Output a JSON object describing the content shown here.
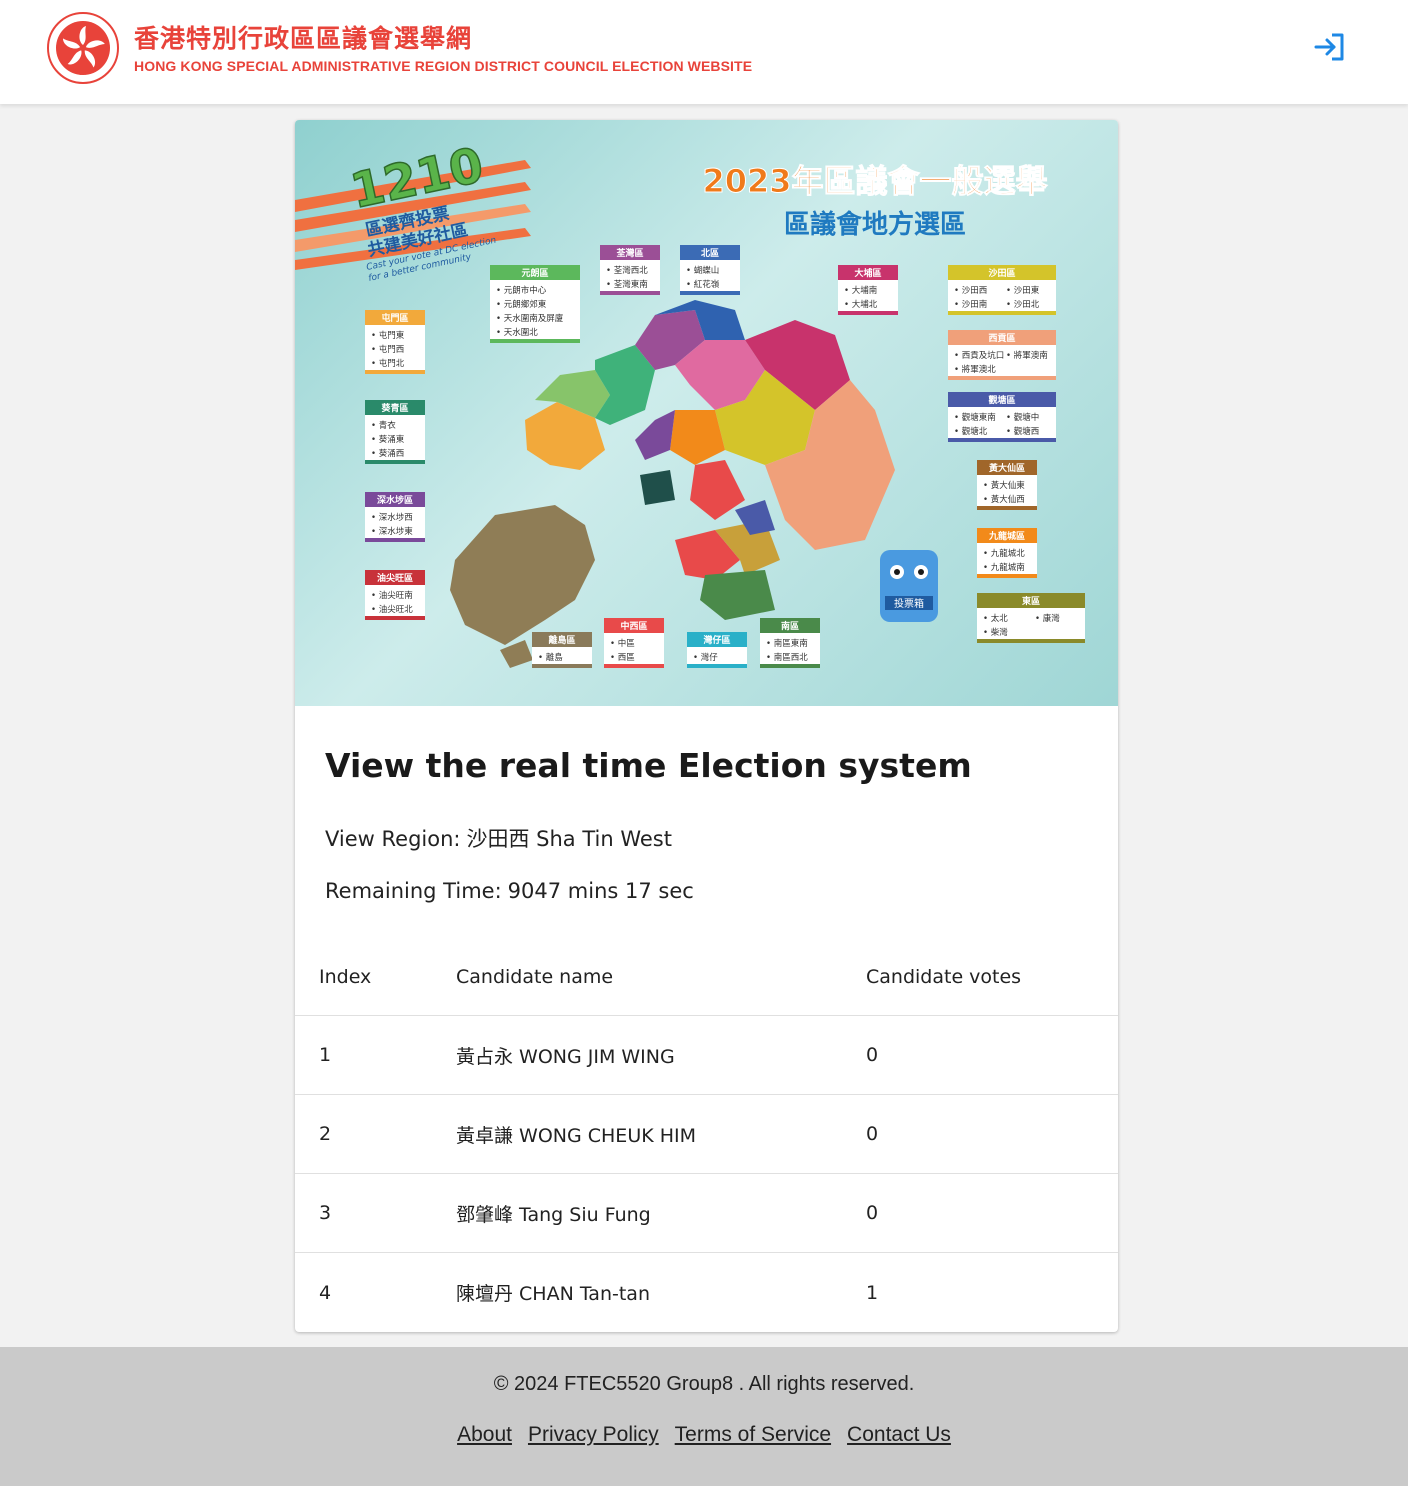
{
  "header": {
    "title_zh": "香港特別行政區區議會選舉網",
    "title_en": "HONG KONG SPECIAL ADMINISTRATIVE REGION DISTRICT COUNCIL ELECTION WEBSITE",
    "login_icon": "login-icon",
    "logo_text": "HONG KONG",
    "brand_color": "#e8433a",
    "accent_color": "#1e88e5"
  },
  "banner": {
    "slogan_number": "1210",
    "slogan_line1": "區選齊投票",
    "slogan_line2": "共建美好社區",
    "slogan_en1": "Cast your vote at DC election",
    "slogan_en2": "for a better community",
    "heading_year": "2023年區議會一般選舉",
    "heading_sub": "區議會地方選區",
    "mascot_label": "投票箱",
    "districts": [
      {
        "name": "屯門區",
        "items": [
          "屯門東",
          "屯門西",
          "屯門北"
        ],
        "color": "#f2a93b"
      },
      {
        "name": "元朗區",
        "items": [
          "元朗市中心",
          "元朗鄉郊東",
          "天水圍南及屏廈",
          "天水圍北"
        ],
        "color": "#5cb85c"
      },
      {
        "name": "荃灣區",
        "items": [
          "荃灣西北",
          "荃灣東南"
        ],
        "color": "#9b4f96"
      },
      {
        "name": "北區",
        "items": [
          "蝴蝶山",
          "紅花嶺"
        ],
        "color": "#3b6bb5"
      },
      {
        "name": "大埔區",
        "items": [
          "大埔南",
          "大埔北"
        ],
        "color": "#c8336c"
      },
      {
        "name": "沙田區",
        "items": [
          "沙田西",
          "沙田東",
          "沙田南",
          "沙田北"
        ],
        "color": "#d4c42a"
      },
      {
        "name": "西貢區",
        "items": [
          "西貢及坑口",
          "將軍澳南",
          "將軍澳北"
        ],
        "color": "#f0a07a"
      },
      {
        "name": "觀塘區",
        "items": [
          "觀塘東南",
          "觀塘中",
          "觀塘北",
          "觀塘西"
        ],
        "color": "#4a5aa8"
      },
      {
        "name": "黃大仙區",
        "items": [
          "黃大仙東",
          "黃大仙西"
        ],
        "color": "#a0662a"
      },
      {
        "name": "九龍城區",
        "items": [
          "九龍城北",
          "九龍城南"
        ],
        "color": "#f28a1a"
      },
      {
        "name": "東區",
        "items": [
          "太北",
          "康灣",
          "柴灣"
        ],
        "color": "#8a8a2a"
      },
      {
        "name": "葵青區",
        "items": [
          "青衣",
          "葵涌東",
          "葵涌西"
        ],
        "color": "#2a8a6a"
      },
      {
        "name": "深水埗區",
        "items": [
          "深水埗西",
          "深水埗東"
        ],
        "color": "#7a4a9a"
      },
      {
        "name": "油尖旺區",
        "items": [
          "油尖旺南",
          "油尖旺北"
        ],
        "color": "#c8323a"
      },
      {
        "name": "離島區",
        "items": [
          "離島"
        ],
        "color": "#8a7a5a"
      },
      {
        "name": "中西區",
        "items": [
          "中區",
          "西區"
        ],
        "color": "#e84a4a"
      },
      {
        "name": "灣仔區",
        "items": [
          "灣仔"
        ],
        "color": "#2ab0c8"
      },
      {
        "name": "南區",
        "items": [
          "南區東南",
          "南區西北"
        ],
        "color": "#4a8a4a"
      }
    ]
  },
  "main": {
    "title": "View the real time Election system",
    "region_label": "View Region:",
    "region_value": "沙田西 Sha Tin West",
    "time_label": "Remaining Time:",
    "time_value": "9047 mins 17 sec"
  },
  "table": {
    "headers": [
      "Index",
      "Candidate name",
      "Candidate votes"
    ],
    "rows": [
      [
        "1",
        "黃占永 WONG JIM WING",
        "0"
      ],
      [
        "2",
        "黃卓謙 WONG CHEUK HIM",
        "0"
      ],
      [
        "3",
        "鄧肇峰 Tang Siu Fung",
        "0"
      ],
      [
        "4",
        "陳壇丹 CHAN Tan-tan",
        "1"
      ]
    ]
  },
  "footer": {
    "copyright": "© 2024 FTEC5520 Group8 . All rights reserved.",
    "links": [
      "About",
      "Privacy Policy",
      "Terms of Service",
      "Contact Us"
    ]
  }
}
